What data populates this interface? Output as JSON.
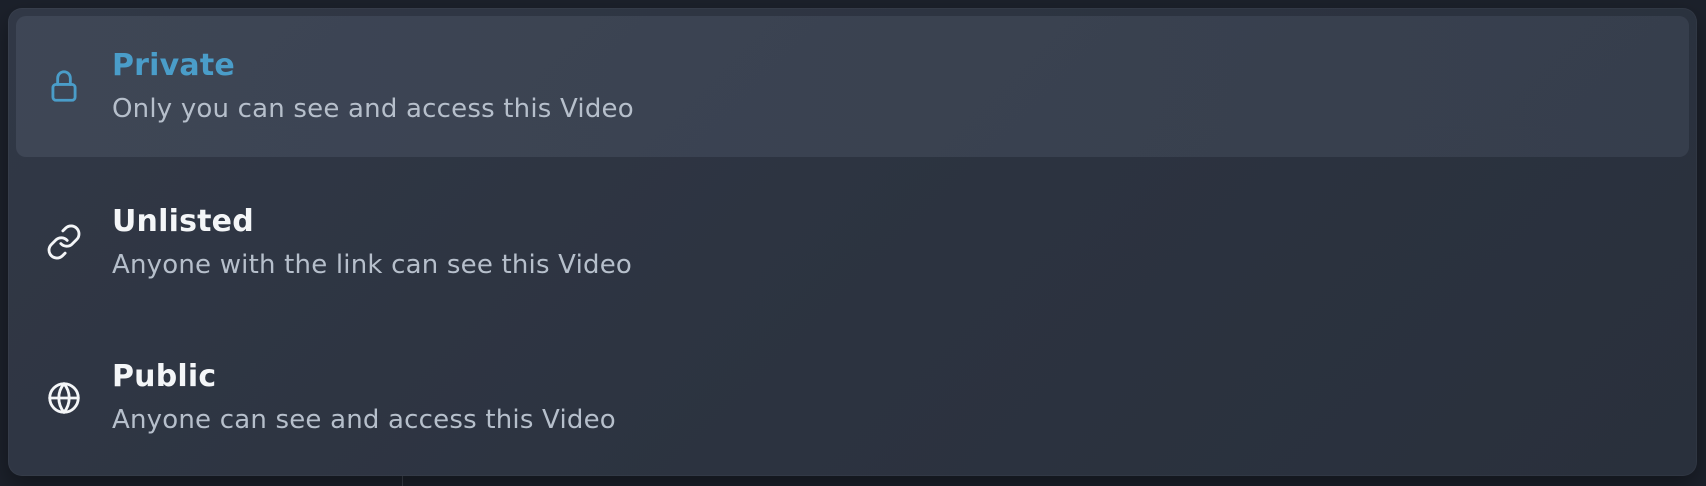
{
  "visibility_menu": {
    "options": [
      {
        "title": "Private",
        "description": "Only you can see and access this Video",
        "icon": "lock-icon",
        "selected": true,
        "title_color": "#4a9dc9",
        "icon_color": "#4a9dc9"
      },
      {
        "title": "Unlisted",
        "description": "Anyone with the link can see this Video",
        "icon": "link-icon",
        "selected": false,
        "title_color": "#f4f6f8",
        "icon_color": "#f4f6f8"
      },
      {
        "title": "Public",
        "description": "Anyone can see and access this Video",
        "icon": "globe-icon",
        "selected": false,
        "title_color": "#f4f6f8",
        "icon_color": "#f4f6f8"
      }
    ]
  }
}
